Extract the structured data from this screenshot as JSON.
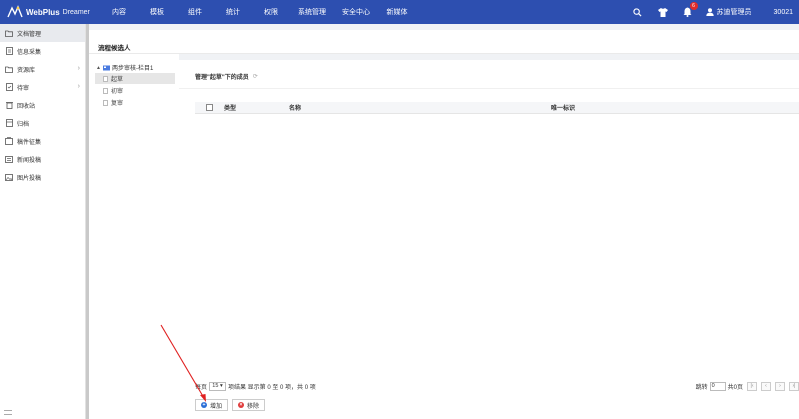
{
  "app": {
    "name": "WebPlus",
    "product": "Dreamer"
  },
  "nav": [
    "内容",
    "模板",
    "组件",
    "统计",
    "权限",
    "系统管理",
    "安全中心",
    "新媒体"
  ],
  "header": {
    "notification_count": "6",
    "user_name": "苏迪管理员",
    "user_id": "30021"
  },
  "sidebar": {
    "items": [
      {
        "label": "文档管理",
        "icon": "folder-open-icon",
        "active": true
      },
      {
        "label": "信息采集",
        "icon": "collect-icon"
      },
      {
        "label": "资源库",
        "icon": "folder-icon",
        "expandable": true
      },
      {
        "label": "待审",
        "icon": "review-icon",
        "expandable": true
      },
      {
        "label": "回收站",
        "icon": "trash-icon"
      },
      {
        "label": "归档",
        "icon": "archive-icon"
      },
      {
        "label": "稿件征集",
        "icon": "collect-docs-icon"
      },
      {
        "label": "新闻投稿",
        "icon": "news-icon"
      },
      {
        "label": "图片投稿",
        "icon": "image-icon"
      }
    ]
  },
  "main": {
    "title": "流程候选人"
  },
  "tree": {
    "root": "两步审核-栏目1",
    "nodes": [
      "起草",
      "初审",
      "复审"
    ],
    "selected": "起草"
  },
  "members": {
    "title": "管理\"起草\"下的成员",
    "columns": {
      "type": "类型",
      "name": "名称",
      "id": "唯一标识"
    }
  },
  "pager": {
    "per_page_label": "每页",
    "per_page_value": "15",
    "summary": "项结果 显示第 0 至 0 项，共 0 项",
    "jump_label": "跳转",
    "jump_value": "0",
    "total_pages": "共0页",
    "first": "|‹",
    "prev": "‹",
    "next": "›",
    "last": "›|"
  },
  "actions": {
    "add": "增加",
    "remove": "移除"
  },
  "colors": {
    "header": "#2d4fb0",
    "add": "#2d6fd6",
    "remove": "#e03a3a",
    "arrow": "#e02020"
  }
}
